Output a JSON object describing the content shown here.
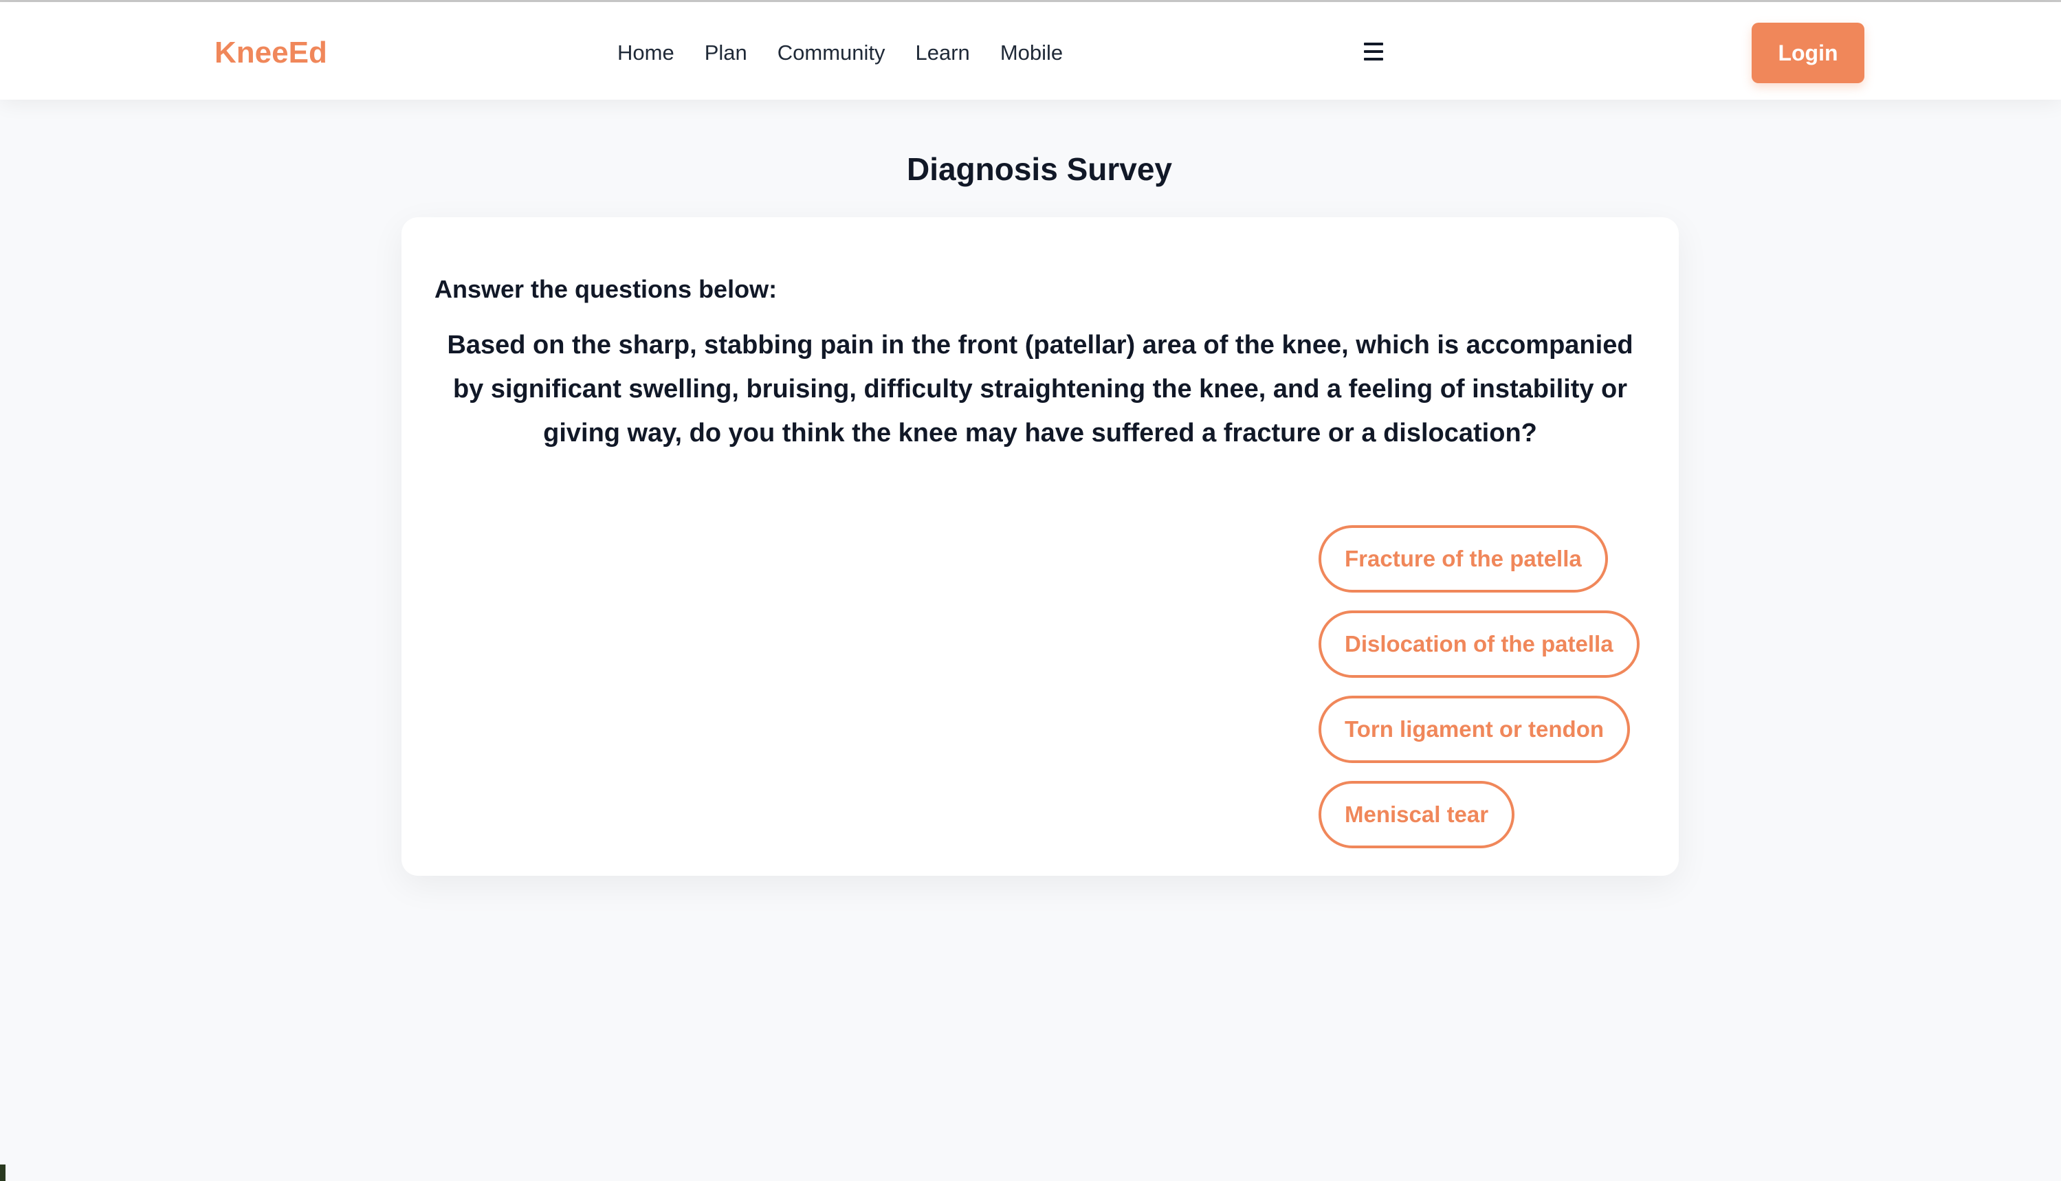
{
  "colors": {
    "accent": "#f0875a",
    "text": "#111827",
    "background": "#f8f9fb",
    "card": "#ffffff"
  },
  "nav": {
    "brand": "KneeEd",
    "links": [
      "Home",
      "Plan",
      "Community",
      "Learn",
      "Mobile"
    ],
    "menu_icon": "hamburger-menu-icon",
    "login_label": "Login"
  },
  "page": {
    "title": "Diagnosis Survey"
  },
  "survey": {
    "instructions": "Answer the questions below:",
    "question": "Based on the sharp, stabbing pain in the front (patellar) area of the knee, which is accompanied by significant swelling, bruising, difficulty straightening the knee, and a feeling of instability or giving way, do you think the knee may have suffered a fracture or a dislocation?",
    "options": [
      "Fracture of the patella",
      "Dislocation of the patella",
      "Torn ligament or tendon",
      "Meniscal tear"
    ]
  }
}
